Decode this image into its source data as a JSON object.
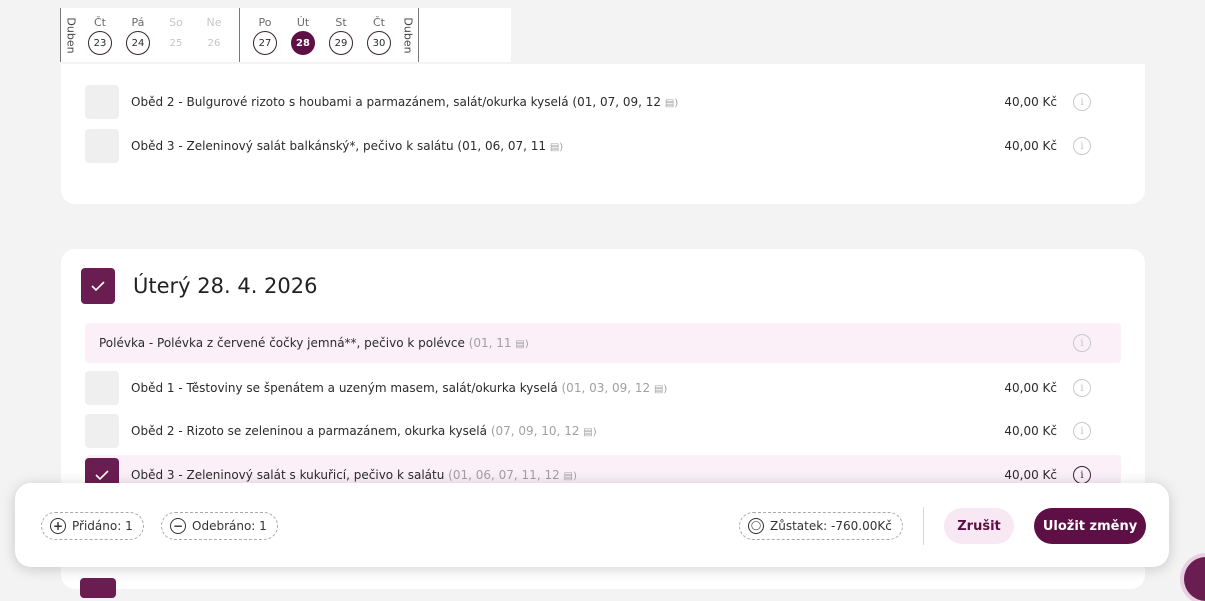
{
  "calendar": {
    "month_left": "Duben",
    "month_right": "Duben",
    "days": [
      {
        "name": "Čt",
        "num": "23"
      },
      {
        "name": "Pá",
        "num": "24"
      },
      {
        "name": "So",
        "num": "25"
      },
      {
        "name": "Ne",
        "num": "26"
      },
      {
        "name": "Po",
        "num": "27"
      },
      {
        "name": "Út",
        "num": "28"
      },
      {
        "name": "St",
        "num": "29"
      },
      {
        "name": "Čt",
        "num": "30"
      }
    ]
  },
  "prev_day": {
    "rows": [
      {
        "label": "Oběd 2 - Bulgurové rizoto s houbami a parmazánem, salát/okurka kyselá (01, 07, 09, 12",
        "price": "40,00 Kč"
      },
      {
        "label": "Oběd 3 - Zeleninový salát balkánský*, pečivo k salátu (01, 06, 07, 11",
        "price": "40,00 Kč"
      }
    ]
  },
  "day": {
    "title": "Úterý 28. 4. 2026",
    "rows": [
      {
        "text": "Polévka - Polévka z červené čočky jemná**, pečivo k polévce",
        "allergens": "(01, 11",
        "price": ""
      },
      {
        "text": "Oběd 1 - Těstoviny se špenátem a uzeným masem, salát/okurka kyselá",
        "allergens": "(01, 03, 09, 12",
        "price": "40,00 Kč"
      },
      {
        "text": "Oběd 2 - Rizoto se zeleninou a parmazánem, okurka kyselá",
        "allergens": "(07, 09, 10, 12",
        "price": "40,00 Kč"
      },
      {
        "text": "Oběd 3 - Zeleninový salát s kukuřicí, pečivo k salátu",
        "allergens": "(01, 06, 07, 11, 12",
        "price": "40,00 Kč"
      }
    ]
  },
  "action_bar": {
    "added": "Přidáno: 1",
    "removed": "Odebráno: 1",
    "balance": "Zůstatek: -760.00Kč",
    "cancel": "Zrušit",
    "save": "Uložit změny"
  },
  "colors": {
    "accent": "#5e0f45",
    "selected_row": "#fbf0f8"
  }
}
